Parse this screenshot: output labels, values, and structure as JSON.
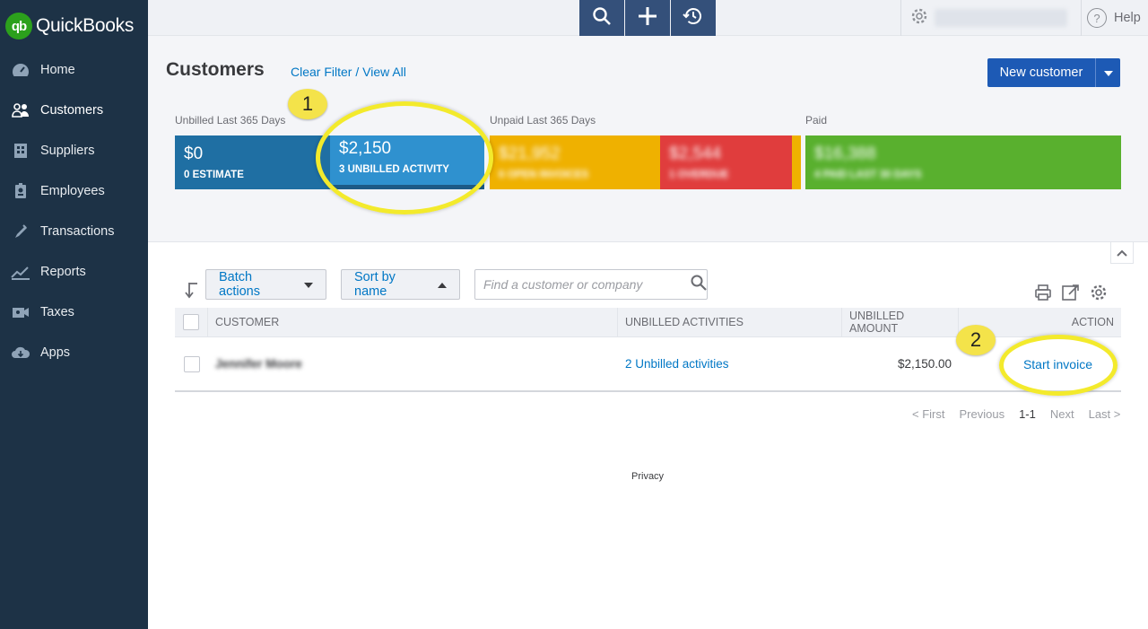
{
  "app": {
    "name": "QuickBooks",
    "logo_mark": "qb"
  },
  "sidebar": {
    "items": [
      {
        "label": "Home",
        "icon": "dashboard-icon"
      },
      {
        "label": "Customers",
        "icon": "customers-icon",
        "active": true
      },
      {
        "label": "Suppliers",
        "icon": "suppliers-icon"
      },
      {
        "label": "Employees",
        "icon": "employees-icon"
      },
      {
        "label": "Transactions",
        "icon": "transactions-icon"
      },
      {
        "label": "Reports",
        "icon": "reports-icon"
      },
      {
        "label": "Taxes",
        "icon": "taxes-icon"
      },
      {
        "label": "Apps",
        "icon": "apps-icon"
      }
    ]
  },
  "topbar": {
    "help_label": "Help"
  },
  "header": {
    "title": "Customers",
    "clear_filter": "Clear Filter / View All",
    "new_customer": "New customer"
  },
  "money_bar": {
    "unbilled_label": "Unbilled Last 365 Days",
    "unpaid_label": "Unpaid Last 365 Days",
    "paid_label": "Paid",
    "estimate": {
      "amount": "$0",
      "caption": "0 ESTIMATE",
      "color": "#1f6fa3"
    },
    "unbilled": {
      "amount": "$2,150",
      "caption": "3 UNBILLED ACTIVITY",
      "color": "#2f91cf"
    },
    "open_invoices": {
      "amount": "$21,952",
      "caption": "6 OPEN INVOICES",
      "color": "#efb100"
    },
    "overdue": {
      "amount": "$2,544",
      "caption": "1 OVERDUE",
      "color": "#e03d3d"
    },
    "paid": {
      "amount": "$16,388",
      "caption": "4 PAID LAST 30 DAYS",
      "color": "#59b02e"
    }
  },
  "annotations": {
    "callout_1": "1",
    "callout_2": "2"
  },
  "toolbar": {
    "batch_actions": "Batch actions",
    "sort_by": "Sort by name",
    "search_placeholder": "Find a customer or company"
  },
  "table": {
    "columns": [
      "CUSTOMER",
      "UNBILLED ACTIVITIES",
      "UNBILLED AMOUNT",
      "ACTION"
    ],
    "rows": [
      {
        "customer": "Jennifer Moore",
        "activities": "2 Unbilled activities",
        "amount": "$2,150.00",
        "action": "Start invoice"
      }
    ]
  },
  "pagination": {
    "first": "< First",
    "previous": "Previous",
    "range": "1-1",
    "next": "Next",
    "last": "Last >"
  },
  "footer": {
    "privacy": "Privacy"
  }
}
